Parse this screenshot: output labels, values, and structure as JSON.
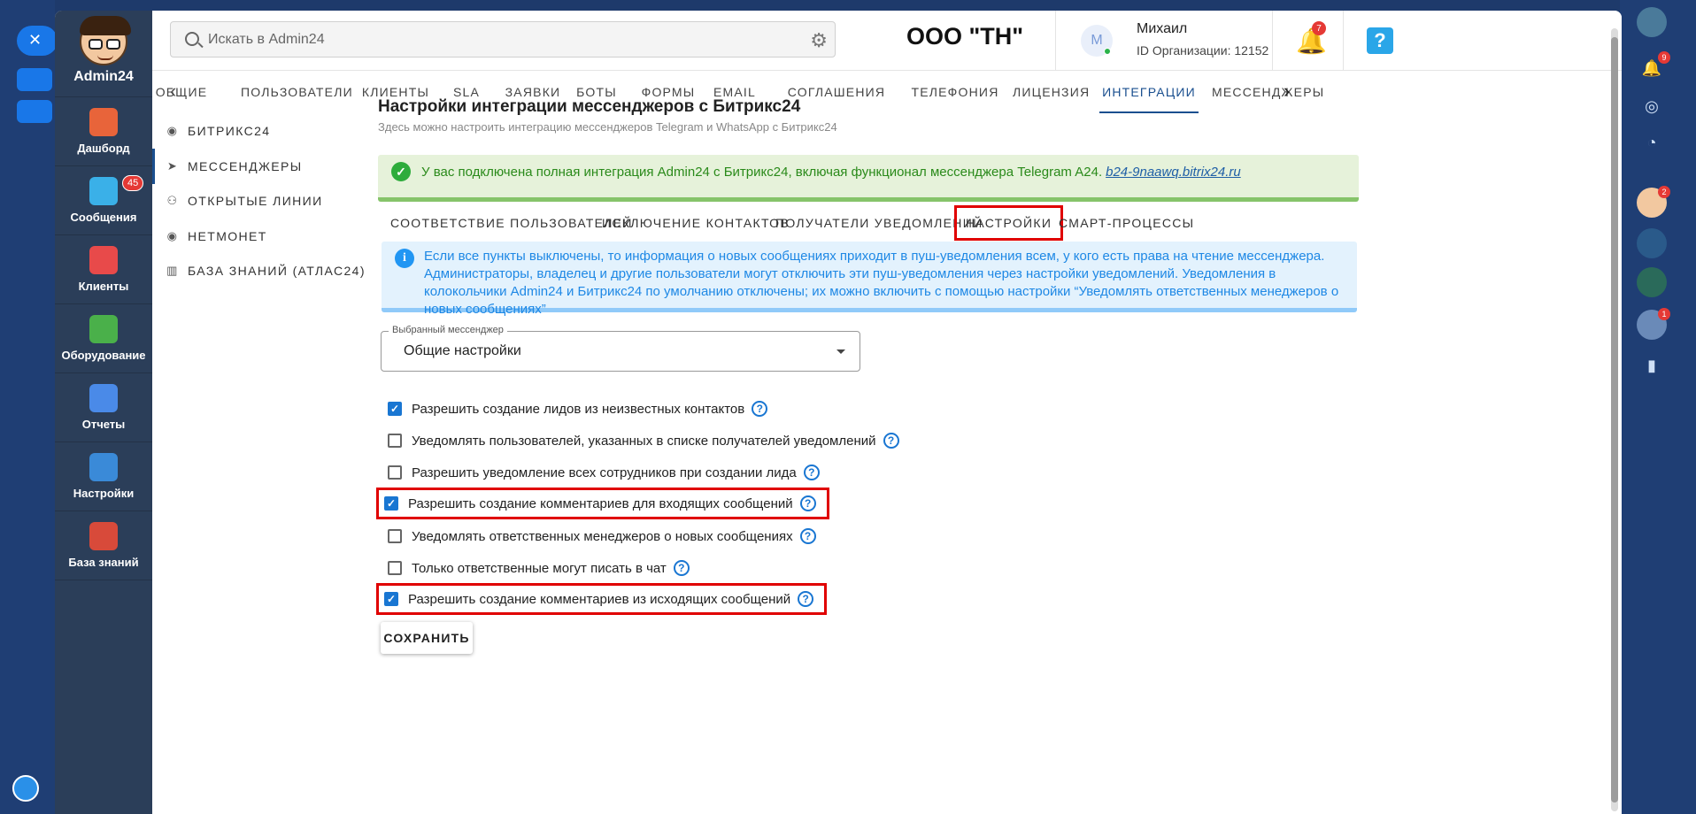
{
  "app": {
    "name": "Admin24"
  },
  "nav": [
    {
      "label": "Дашборд",
      "icon": "dashboard-icon",
      "color": "#e8643a"
    },
    {
      "label": "Сообщения",
      "icon": "chat-icon",
      "color": "#3ab0e8",
      "badge": "45"
    },
    {
      "label": "Клиенты",
      "icon": "clients-icon",
      "color": "#e84a4a"
    },
    {
      "label": "Оборудование",
      "icon": "equipment-icon",
      "color": "#4ab04a"
    },
    {
      "label": "Отчеты",
      "icon": "reports-icon",
      "color": "#4a8ae8"
    },
    {
      "label": "Настройки",
      "icon": "gear-icon",
      "color": "#3a8ad8"
    },
    {
      "label": "База знаний",
      "icon": "book-icon",
      "color": "#d84a3a"
    }
  ],
  "topbar": {
    "search_placeholder": "Искать в Admin24",
    "org_title": "ООО \"ТН\"",
    "avatar_letter": "М",
    "user_name": "Михаил",
    "org_id": "ID Организации: 12152",
    "bell_count": "7"
  },
  "tabs": [
    "ОБЩИЕ",
    "ПОЛЬЗОВАТЕЛИ",
    "КЛИЕНТЫ",
    "SLA",
    "ЗАЯВКИ",
    "БОТЫ",
    "ФОРМЫ",
    "EMAIL",
    "СОГЛАШЕНИЯ",
    "ТЕЛЕФОНИЯ",
    "ЛИЦЕНЗИЯ",
    "ИНТЕГРАЦИИ",
    "МЕССЕНДЖЕРЫ"
  ],
  "side_menu": [
    "БИТРИКС24",
    "МЕССЕНДЖЕРЫ",
    "ОТКРЫТЫЕ ЛИНИИ",
    "НЕТМОНЕТ",
    "БАЗА ЗНАНИЙ (АТЛАС24)"
  ],
  "main": {
    "title": "Настройки интеграции мессенджеров с Битрикс24",
    "subtitle": "Здесь можно настроить интеграцию мессенджеров Telegram и WhatsApp с Битрикс24",
    "success_text": "У вас подключена полная интеграция Admin24 с Битрикс24, включая функционал мессенджера Telegram A24.",
    "success_link": "b24-9naawq.bitrix24.ru",
    "inner_tabs": [
      "СООТВЕТСТВИЕ ПОЛЬЗОВАТЕЛЕЙ",
      "ИСКЛЮЧЕНИЕ КОНТАКТОВ",
      "ПОЛУЧАТЕЛИ УВЕДОМЛЕНИЙ",
      "НАСТРОЙКИ",
      "СМАРТ-ПРОЦЕССЫ"
    ],
    "info_text": "Если все пункты выключены, то информация о новых сообщениях приходит в пуш-уведомления всем, у кого есть права на чтение мессенджера. Администраторы, владелец и другие пользователи могут отключить эти пуш-уведомления через настройки уведомлений. Уведомления в колокольчики Admin24 и Битрикс24 по умолчанию отключены; их можно включить с помощью настройки “Уведомлять ответственных менеджеров о новых сообщениях”",
    "select_label": "Выбранный мессенджер",
    "select_value": "Общие настройки",
    "checkboxes": [
      {
        "label": "Разрешить создание лидов из неизвестных контактов",
        "checked": true
      },
      {
        "label": "Уведомлять пользователей, указанных в списке получателей уведомлений",
        "checked": false
      },
      {
        "label": "Разрешить уведомление всех сотрудников при создании лида",
        "checked": false
      },
      {
        "label": "Разрешить создание комментариев для входящих сообщений",
        "checked": true
      },
      {
        "label": "Уведомлять ответственных менеджеров о новых сообщениях",
        "checked": false
      },
      {
        "label": "Только ответственные могут писать в чат",
        "checked": false
      },
      {
        "label": "Разрешить создание комментариев из исходящих сообщений",
        "checked": true
      }
    ],
    "save_label": "СОХРАНИТЬ"
  },
  "right_rail": {
    "notif_count": "9",
    "avatar1_count": "2",
    "avatar2_count": "1"
  }
}
